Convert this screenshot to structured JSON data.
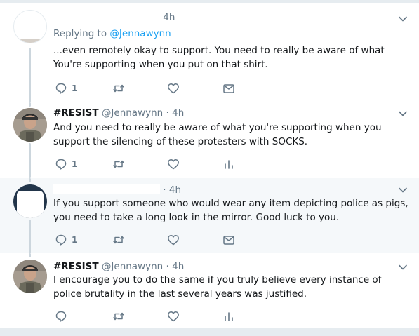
{
  "tweets": [
    {
      "id": "t1",
      "time": "4h",
      "reply_to_label": "Replying to",
      "reply_to_handle": "@Jennawynn",
      "text": "...even remotely okay to support.  You need to really be aware of what You're supporting when you put on that shirt.",
      "reply_count": "1",
      "avatar": "white-avatar",
      "highlighted": false
    },
    {
      "id": "t2",
      "name": "#RESIST",
      "handle": "@Jennawynn",
      "dot": "·",
      "time": "4h",
      "text": "And you need to really be aware of what you're supporting when you support the silencing of these protesters with SOCKS.",
      "reply_count": "1",
      "avatar": "profile-photo",
      "highlighted": false
    },
    {
      "id": "t3",
      "dot": "·",
      "time": "4h",
      "text": "If you support someone who would wear any item depicting police as pigs, you need to take a long look in the mirror. Good luck to you.",
      "reply_count": "1",
      "avatar": "navy-avatar",
      "highlighted": true
    },
    {
      "id": "t4",
      "name": "#RESIST",
      "handle": "@Jennawynn",
      "dot": "·",
      "time": "4h",
      "text": "I encourage you to do the same if you truly believe every instance of police brutality in the last several years was justified.",
      "reply_count": "",
      "avatar": "profile-photo",
      "highlighted": false
    }
  ],
  "colors": {
    "accent": "#1da1f2",
    "secondary_text": "#657786",
    "primary_text": "#14171a",
    "highlight_bg": "#f5f8fa",
    "thread_line": "#ccd6dd",
    "border": "#e6ecf0"
  },
  "icons": [
    "reply-icon",
    "retweet-icon",
    "like-icon",
    "direct-message-icon",
    "analytics-icon",
    "chevron-down-icon"
  ]
}
